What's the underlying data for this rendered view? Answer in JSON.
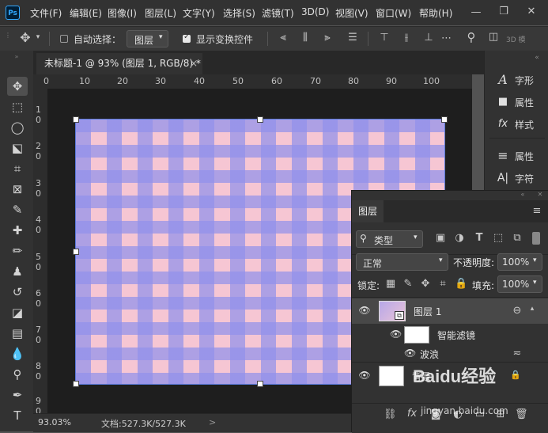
{
  "menu": {
    "logo": "Ps",
    "items": [
      "文件(F)",
      "编辑(E)",
      "图像(I)",
      "图层(L)",
      "文字(Y)",
      "选择(S)",
      "滤镜(T)",
      "3D(D)",
      "视图(V)",
      "窗口(W)",
      "帮助(H)"
    ]
  },
  "options": {
    "auto_select_label": "自动选择：",
    "auto_select_value": "图层",
    "transform_label": "显示变换控件",
    "mode_3d": "3D 模"
  },
  "document": {
    "tab_title": "未标题-1 @ 93% (图层 1, RGB/8) *",
    "close": "×"
  },
  "ruler": {
    "top_ticks": [
      "0",
      "10",
      "20",
      "30",
      "40",
      "50",
      "60",
      "70",
      "80",
      "90",
      "100"
    ],
    "left_ticks": [
      "1 0",
      "2 0",
      "3 0",
      "4 0",
      "5 0",
      "6 0",
      "7 0",
      "8 0",
      "9 0"
    ]
  },
  "status": {
    "zoom": "93.03%",
    "doc_info": "文档:527.3K/527.3K",
    "arrow": ">"
  },
  "panel_strip": {
    "items": [
      {
        "label": "字形",
        "icon": "A"
      },
      {
        "label": "属性",
        "icon": "■"
      },
      {
        "label": "样式",
        "icon": "fx"
      },
      {
        "label": "属性",
        "icon": "≡"
      },
      {
        "label": "字符",
        "icon": "A|"
      }
    ]
  },
  "layers": {
    "tab": "图层",
    "filter_kind": "类型",
    "blend_mode": "正常",
    "opacity_label": "不透明度:",
    "opacity_value": "100%",
    "lock_label": "锁定:",
    "fill_label": "填充:",
    "fill_value": "100%",
    "rows": [
      {
        "name": "图层 1",
        "selected": true
      },
      {
        "name": "智能滤镜"
      },
      {
        "name": "波浪"
      },
      {
        "name": "背景"
      }
    ],
    "footer_fx": "fx"
  },
  "watermark": {
    "text": "Baidu经验",
    "sub": "jingyan.baidu.com"
  }
}
